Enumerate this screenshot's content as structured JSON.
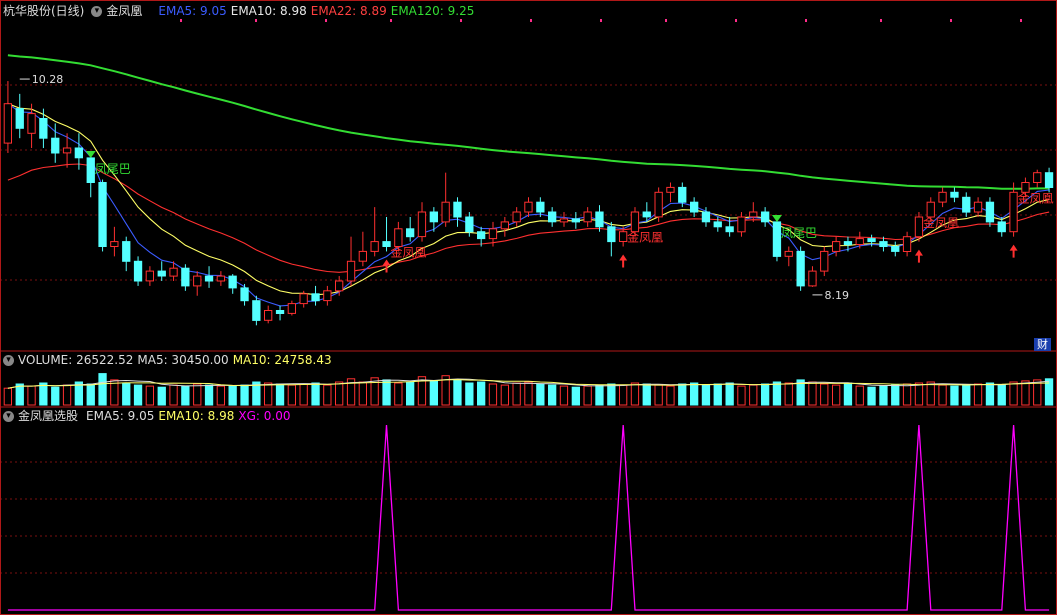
{
  "header": {
    "stock": "杭华股份(日线)",
    "indicator": "金凤凰",
    "ma": [
      {
        "label": "EMA5: 9.05",
        "color": "#3b5cff"
      },
      {
        "label": "EMA10: 8.98",
        "color": "#e8e8e8"
      },
      {
        "label": "EMA22: 8.89",
        "color": "#ff4040"
      },
      {
        "label": "EMA120: 9.25",
        "color": "#33dd33"
      }
    ]
  },
  "volume_header": {
    "label": "VOLUME: 26522.52",
    "ma5": "MA5: 30450.00",
    "ma10": "MA10: 24758.43"
  },
  "indicator_header": {
    "name": "金凤凰选股",
    "ema5": "EMA5: 9.05",
    "ema10": "EMA10: 8.98",
    "xg": "XG: 0.00"
  },
  "badge": "财",
  "colors": {
    "up": "#ff3030",
    "down": "#54ffff",
    "ema5": "#3b5cff",
    "ema10": "#ffff66",
    "ema22": "#ff3030",
    "ema120": "#33dd33",
    "xg": "#ff00ff",
    "grid": "#7a1010"
  },
  "chart_data": [
    {
      "type": "candlestick",
      "title": "杭华股份(日线)",
      "ylim": [
        7.6,
        10.9
      ],
      "annotations": [
        {
          "text": "10.28",
          "type": "high",
          "index": 1,
          "value": 10.28
        },
        {
          "text": "8.19",
          "type": "low",
          "index": 68,
          "value": 8.19
        },
        {
          "text": "凤尾巴",
          "type": "signal",
          "index": 7,
          "color": "#33dd33"
        },
        {
          "text": "凤尾巴",
          "type": "signal",
          "index": 65,
          "color": "#33dd33"
        },
        {
          "text": "金凤凰",
          "type": "signal",
          "index": 32,
          "color": "#ff3030"
        },
        {
          "text": "金凤凰",
          "type": "signal",
          "index": 52,
          "color": "#ff3030"
        },
        {
          "text": "金凤凰",
          "type": "signal",
          "index": 77,
          "color": "#ff3030"
        },
        {
          "text": "金凤凰",
          "type": "signal",
          "index": 85,
          "color": "#ff3030"
        }
      ],
      "candles": [
        [
          9.65,
          10.05,
          10.28,
          9.55
        ],
        [
          10.0,
          9.8,
          10.15,
          9.7
        ],
        [
          9.75,
          9.95,
          10.05,
          9.6
        ],
        [
          9.9,
          9.7,
          10.0,
          9.6
        ],
        [
          9.7,
          9.55,
          9.85,
          9.45
        ],
        [
          9.55,
          9.6,
          9.75,
          9.4
        ],
        [
          9.6,
          9.5,
          9.75,
          9.38
        ],
        [
          9.5,
          9.25,
          9.55,
          9.1
        ],
        [
          9.25,
          8.6,
          9.28,
          8.55
        ],
        [
          8.6,
          8.65,
          8.8,
          8.5
        ],
        [
          8.65,
          8.45,
          8.7,
          8.35
        ],
        [
          8.45,
          8.25,
          8.5,
          8.2
        ],
        [
          8.25,
          8.35,
          8.4,
          8.2
        ],
        [
          8.35,
          8.3,
          8.45,
          8.25
        ],
        [
          8.3,
          8.38,
          8.45,
          8.25
        ],
        [
          8.38,
          8.2,
          8.42,
          8.15
        ],
        [
          8.2,
          8.3,
          8.35,
          8.1
        ],
        [
          8.3,
          8.25,
          8.4,
          8.18
        ],
        [
          8.25,
          8.3,
          8.35,
          8.2
        ],
        [
          8.3,
          8.18,
          8.32,
          8.12
        ],
        [
          8.18,
          8.05,
          8.22,
          8.0
        ],
        [
          8.05,
          7.85,
          8.1,
          7.8
        ],
        [
          7.85,
          7.95,
          8.0,
          7.82
        ],
        [
          7.95,
          7.92,
          8.0,
          7.85
        ],
        [
          7.92,
          8.02,
          8.05,
          7.9
        ],
        [
          8.02,
          8.12,
          8.15,
          7.98
        ],
        [
          8.12,
          8.05,
          8.2,
          8.0
        ],
        [
          8.05,
          8.15,
          8.2,
          8.0
        ],
        [
          8.15,
          8.25,
          8.3,
          8.1
        ],
        [
          8.25,
          8.45,
          8.7,
          8.2
        ],
        [
          8.45,
          8.55,
          8.75,
          8.4
        ],
        [
          8.55,
          8.65,
          9.0,
          8.5
        ],
        [
          8.65,
          8.6,
          8.9,
          8.55
        ],
        [
          8.6,
          8.78,
          8.85,
          8.55
        ],
        [
          8.78,
          8.7,
          8.9,
          8.65
        ],
        [
          8.7,
          8.95,
          9.05,
          8.65
        ],
        [
          8.95,
          8.85,
          9.0,
          8.75
        ],
        [
          8.85,
          9.05,
          9.35,
          8.8
        ],
        [
          9.05,
          8.9,
          9.1,
          8.8
        ],
        [
          8.9,
          8.75,
          8.95,
          8.7
        ],
        [
          8.75,
          8.68,
          8.8,
          8.6
        ],
        [
          8.68,
          8.78,
          8.85,
          8.6
        ],
        [
          8.78,
          8.85,
          8.9,
          8.7
        ],
        [
          8.85,
          8.95,
          9.0,
          8.8
        ],
        [
          8.95,
          9.05,
          9.1,
          8.9
        ],
        [
          9.05,
          8.95,
          9.1,
          8.9
        ],
        [
          8.95,
          8.85,
          9.0,
          8.8
        ],
        [
          8.85,
          8.88,
          8.95,
          8.8
        ],
        [
          8.88,
          8.85,
          8.95,
          8.78
        ],
        [
          8.85,
          8.95,
          9.0,
          8.8
        ],
        [
          8.95,
          8.8,
          9.02,
          8.75
        ],
        [
          8.8,
          8.65,
          8.85,
          8.5
        ],
        [
          8.65,
          8.75,
          8.8,
          8.6
        ],
        [
          8.75,
          8.95,
          9.0,
          8.7
        ],
        [
          8.95,
          8.9,
          9.05,
          8.85
        ],
        [
          8.9,
          9.15,
          9.2,
          8.85
        ],
        [
          9.15,
          9.2,
          9.25,
          9.05
        ],
        [
          9.2,
          9.05,
          9.25,
          9.0
        ],
        [
          9.05,
          8.95,
          9.1,
          8.9
        ],
        [
          8.95,
          8.85,
          9.0,
          8.8
        ],
        [
          8.85,
          8.8,
          8.9,
          8.75
        ],
        [
          8.8,
          8.75,
          8.9,
          8.7
        ],
        [
          8.75,
          8.9,
          8.95,
          8.7
        ],
        [
          8.9,
          8.95,
          9.05,
          8.85
        ],
        [
          8.95,
          8.85,
          9.0,
          8.8
        ],
        [
          8.85,
          8.5,
          8.9,
          8.45
        ],
        [
          8.5,
          8.55,
          8.6,
          8.4
        ],
        [
          8.55,
          8.2,
          8.6,
          8.15
        ],
        [
          8.2,
          8.35,
          8.4,
          8.19
        ],
        [
          8.35,
          8.55,
          8.6,
          8.3
        ],
        [
          8.55,
          8.65,
          8.7,
          8.5
        ],
        [
          8.65,
          8.62,
          8.7,
          8.55
        ],
        [
          8.62,
          8.68,
          8.75,
          8.58
        ],
        [
          8.68,
          8.65,
          8.72,
          8.6
        ],
        [
          8.65,
          8.6,
          8.7,
          8.55
        ],
        [
          8.6,
          8.55,
          8.65,
          8.5
        ],
        [
          8.55,
          8.7,
          8.75,
          8.5
        ],
        [
          8.7,
          8.9,
          8.95,
          8.65
        ],
        [
          8.9,
          9.05,
          9.1,
          8.85
        ],
        [
          9.05,
          9.15,
          9.2,
          9.0
        ],
        [
          9.15,
          9.1,
          9.2,
          9.05
        ],
        [
          9.1,
          8.95,
          9.15,
          8.9
        ],
        [
          8.95,
          9.05,
          9.1,
          8.9
        ],
        [
          9.05,
          8.85,
          9.1,
          8.8
        ],
        [
          8.85,
          8.75,
          8.9,
          8.7
        ],
        [
          8.75,
          9.15,
          9.25,
          8.7
        ],
        [
          9.15,
          9.25,
          9.3,
          9.1
        ],
        [
          9.25,
          9.35,
          9.38,
          9.2
        ],
        [
          9.35,
          9.2,
          9.4,
          9.15
        ]
      ]
    },
    {
      "type": "bar",
      "title": "VOLUME",
      "values": [
        16,
        20,
        18,
        21,
        17,
        19,
        22,
        20,
        30,
        24,
        21,
        19,
        18,
        17,
        19,
        18,
        20,
        19,
        18,
        18,
        19,
        22,
        21,
        20,
        19,
        20,
        21,
        19,
        22,
        25,
        22,
        26,
        24,
        21,
        22,
        27,
        23,
        28,
        24,
        21,
        22,
        20,
        19,
        21,
        22,
        20,
        19,
        18,
        17,
        18,
        19,
        20,
        19,
        21,
        20,
        19,
        18,
        20,
        21,
        19,
        20,
        21,
        18,
        19,
        20,
        22,
        21,
        24,
        22,
        20,
        19,
        21,
        18,
        17,
        18,
        19,
        20,
        21,
        22,
        19,
        18,
        19,
        20,
        21,
        19,
        22,
        23,
        24,
        25
      ]
    },
    {
      "type": "line",
      "title": "金凤凰选股",
      "series": [
        {
          "name": "XG",
          "values": [
            0,
            0,
            0,
            0,
            0,
            0,
            0,
            0,
            0,
            0,
            0,
            0,
            0,
            0,
            0,
            0,
            0,
            0,
            0,
            0,
            0,
            0,
            0,
            0,
            0,
            0,
            0,
            0,
            0,
            0,
            0,
            0,
            1,
            0,
            0,
            0,
            0,
            0,
            0,
            0,
            0,
            0,
            0,
            0,
            0,
            0,
            0,
            0,
            0,
            0,
            0,
            0,
            1,
            0,
            0,
            0,
            0,
            0,
            0,
            0,
            0,
            0,
            0,
            0,
            0,
            0,
            0,
            0,
            0,
            0,
            0,
            0,
            0,
            0,
            0,
            0,
            0,
            1,
            0,
            0,
            0,
            0,
            0,
            0,
            0,
            1,
            0,
            0,
            0
          ]
        }
      ],
      "ylim": [
        0,
        1
      ]
    }
  ]
}
